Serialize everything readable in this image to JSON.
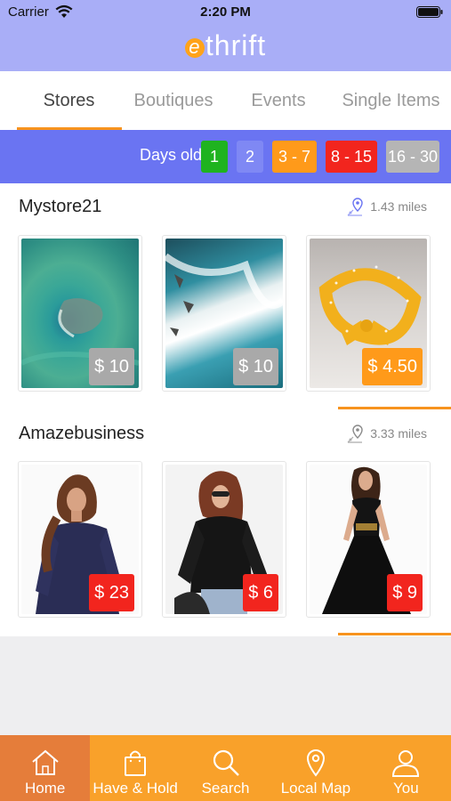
{
  "status": {
    "carrier": "Carrier",
    "time": "2:20 PM"
  },
  "app": {
    "logo_e": "e",
    "logo_rest": "thrift"
  },
  "tabs": [
    {
      "label": "Stores",
      "active": true
    },
    {
      "label": "Boutiques",
      "active": false
    },
    {
      "label": "Events",
      "active": false
    },
    {
      "label": "Single Items",
      "active": false
    }
  ],
  "days_filter": {
    "label": "Days old",
    "chips": [
      {
        "label": "1",
        "color": "#1fb31f"
      },
      {
        "label": "2",
        "color": "#7f88f4"
      },
      {
        "label": "3 - 7",
        "color": "#ff9a1a"
      },
      {
        "label": "8 - 15",
        "color": "#f2251e"
      },
      {
        "label": "16 - 30",
        "color": "#b5b5b5"
      }
    ]
  },
  "stores": [
    {
      "name": "Mystore21",
      "distance": "1.43 miles",
      "items": [
        {
          "price": "$ 10",
          "price_color": "#a9a9a9",
          "image": "aerial-ocean"
        },
        {
          "price": "$ 10",
          "price_color": "#a9a9a9",
          "image": "waves-rocks"
        },
        {
          "price": "$ 4.50",
          "price_color": "#ff9a1a",
          "image": "yellow-headband"
        }
      ]
    },
    {
      "name": "Amazebusiness",
      "distance": "3.33 miles",
      "items": [
        {
          "price": "$ 23",
          "price_color": "#f2251e",
          "image": "navy-lace-top"
        },
        {
          "price": "$ 6",
          "price_color": "#f2251e",
          "image": "black-mesh-top"
        },
        {
          "price": "$ 9",
          "price_color": "#f2251e",
          "image": "black-dress"
        }
      ]
    }
  ],
  "bottom_nav": [
    {
      "label": "Home",
      "icon": "home-icon",
      "active": true
    },
    {
      "label": "Have & Hold",
      "icon": "shopping-bag-icon",
      "active": false
    },
    {
      "label": "Search",
      "icon": "search-icon",
      "active": false
    },
    {
      "label": "Local Map",
      "icon": "map-pin-icon",
      "active": false
    },
    {
      "label": "You",
      "icon": "user-icon",
      "active": false
    }
  ]
}
